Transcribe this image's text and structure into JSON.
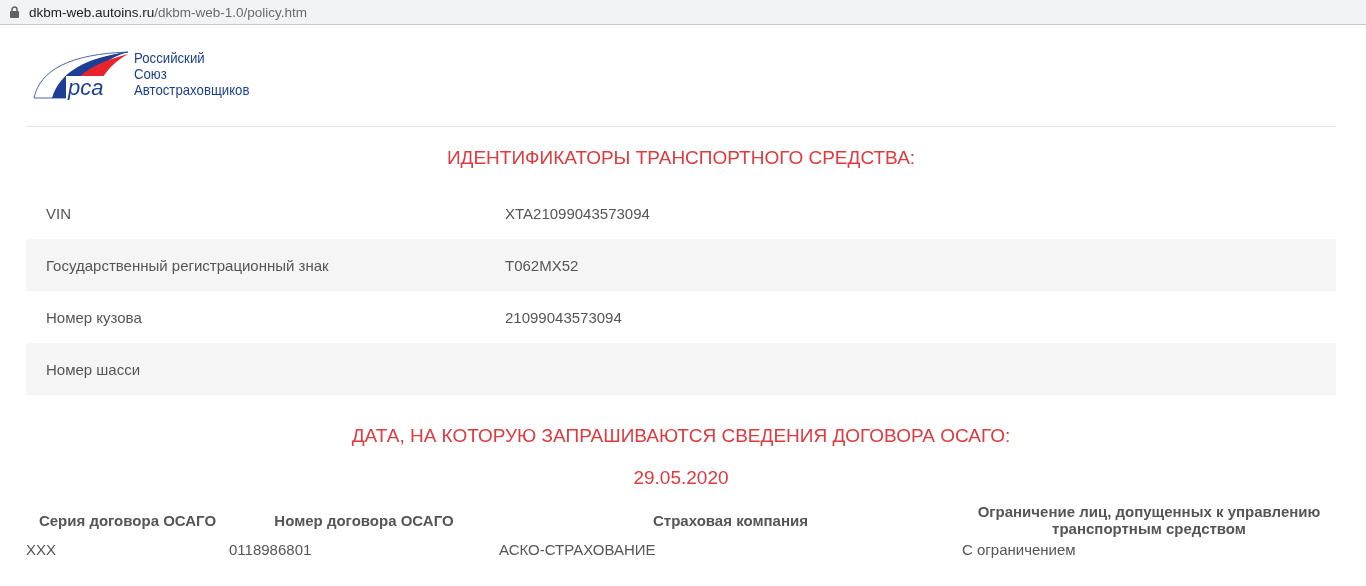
{
  "address_bar": {
    "domain": "dkbm-web.autoins.ru",
    "path": "/dkbm-web-1.0/policy.htm"
  },
  "logo": {
    "mark": "рса",
    "lines": [
      "Российский",
      "Союз",
      "Автостраховщиков"
    ]
  },
  "vehicle_section": {
    "title": "ИДЕНТИФИКАТОРЫ ТРАНСПОРТНОГО СРЕДСТВА:",
    "rows": [
      {
        "label": "VIN",
        "value": "XTA21099043573094"
      },
      {
        "label": "Государственный регистрационный знак",
        "value": "Т062МХ52"
      },
      {
        "label": "Номер кузова",
        "value": "21099043573094"
      },
      {
        "label": "Номер шасси",
        "value": ""
      }
    ]
  },
  "date_section": {
    "title": "ДАТА, НА КОТОРУЮ ЗАПРАШИВАЮТСЯ СВЕДЕНИЯ ДОГОВОРА ОСАГО:",
    "date": "29.05.2020"
  },
  "policy_table": {
    "columns": [
      "Серия договора ОСАГО",
      "Номер договора ОСАГО",
      "Страховая компания",
      "Ограничение лиц, допущенных к управлению транспортным средством"
    ],
    "rows": [
      [
        "XXX",
        "0118986801",
        "АСКО-СТРАХОВАНИЕ",
        "С ограничением"
      ]
    ]
  }
}
